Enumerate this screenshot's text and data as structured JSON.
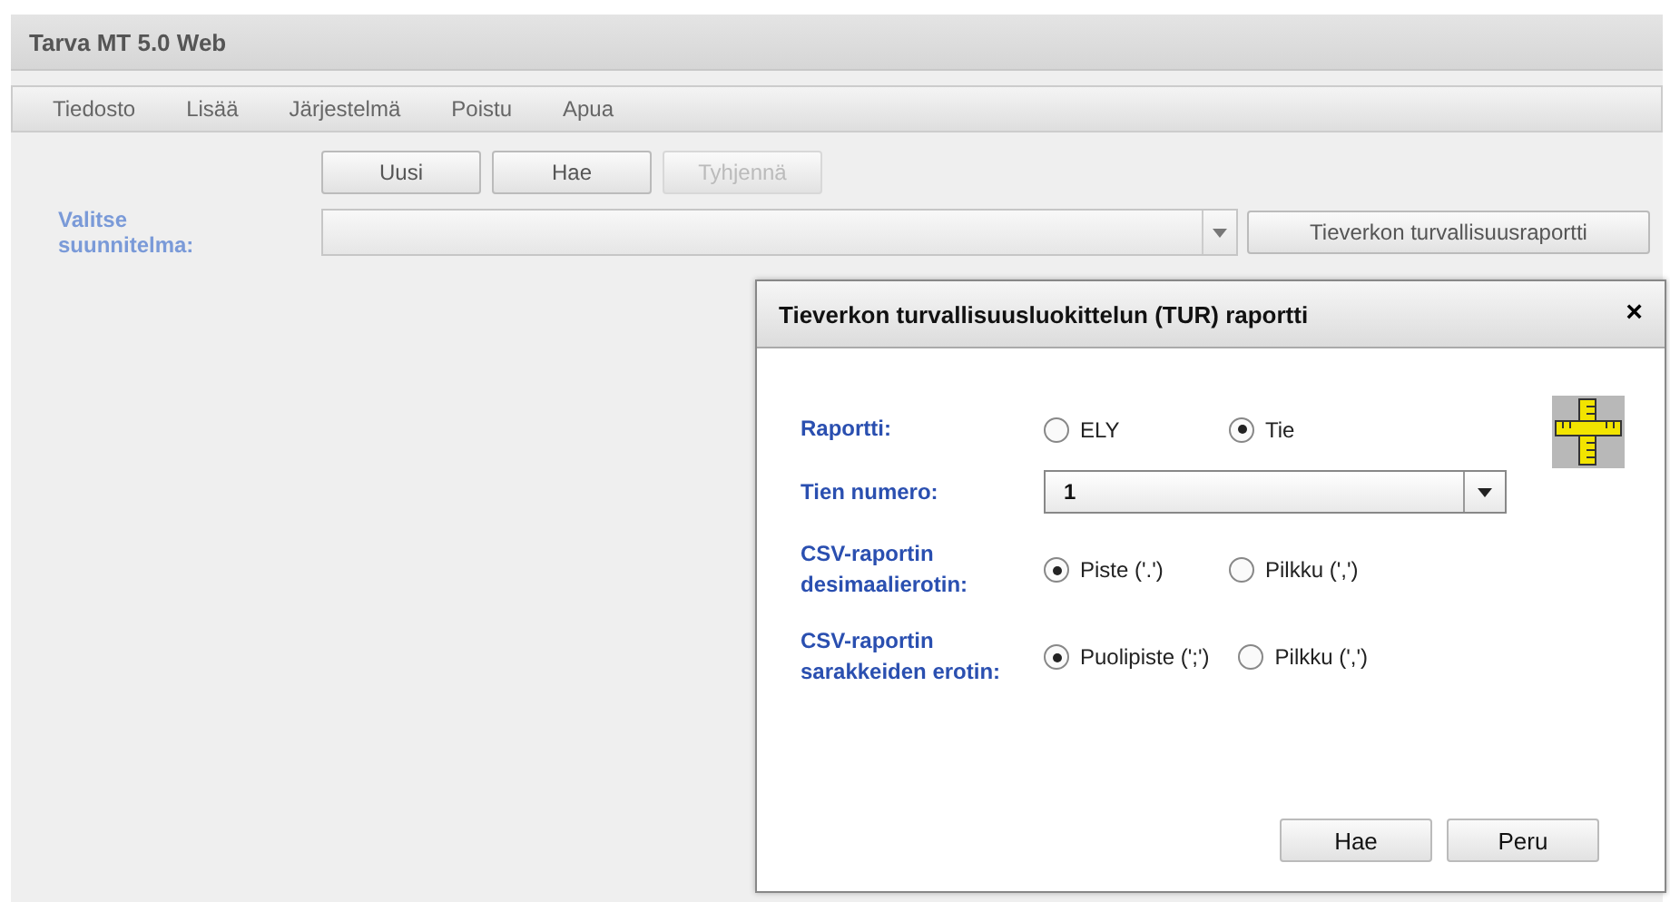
{
  "window": {
    "title": "Tarva MT 5.0 Web"
  },
  "menu": [
    "Tiedosto",
    "Lisää",
    "Järjestelmä",
    "Poistu",
    "Apua"
  ],
  "toolbar": [
    {
      "label": "Uusi",
      "disabled": false
    },
    {
      "label": "Hae",
      "disabled": false
    },
    {
      "label": "Tyhjennä",
      "disabled": true
    }
  ],
  "plan": {
    "label": "Valitse suunnitelma:",
    "report_button": "Tieverkon turvallisuusraportti"
  },
  "dialog": {
    "title": "Tieverkon turvallisuusluokittelun (TUR) raportti",
    "close": "×",
    "rows": [
      {
        "kind": "radio",
        "label": "Raportti:",
        "options": [
          {
            "label": "ELY",
            "selected": false
          },
          {
            "label": "Tie",
            "selected": true
          }
        ]
      },
      {
        "kind": "select",
        "label": "Tien numero:",
        "value": "1"
      },
      {
        "kind": "radio",
        "label": "CSV-raportin desimaalierotin:",
        "options": [
          {
            "label": "Piste ('.')",
            "selected": true
          },
          {
            "label": "Pilkku (',')",
            "selected": false
          }
        ]
      },
      {
        "kind": "radio",
        "label": "CSV-raportin sarakkeiden erotin:",
        "options": [
          {
            "label": "Puolipiste (';')",
            "selected": true
          },
          {
            "label": "Pilkku (',')",
            "selected": false
          }
        ]
      }
    ],
    "buttons": [
      "Hae",
      "Peru"
    ]
  }
}
